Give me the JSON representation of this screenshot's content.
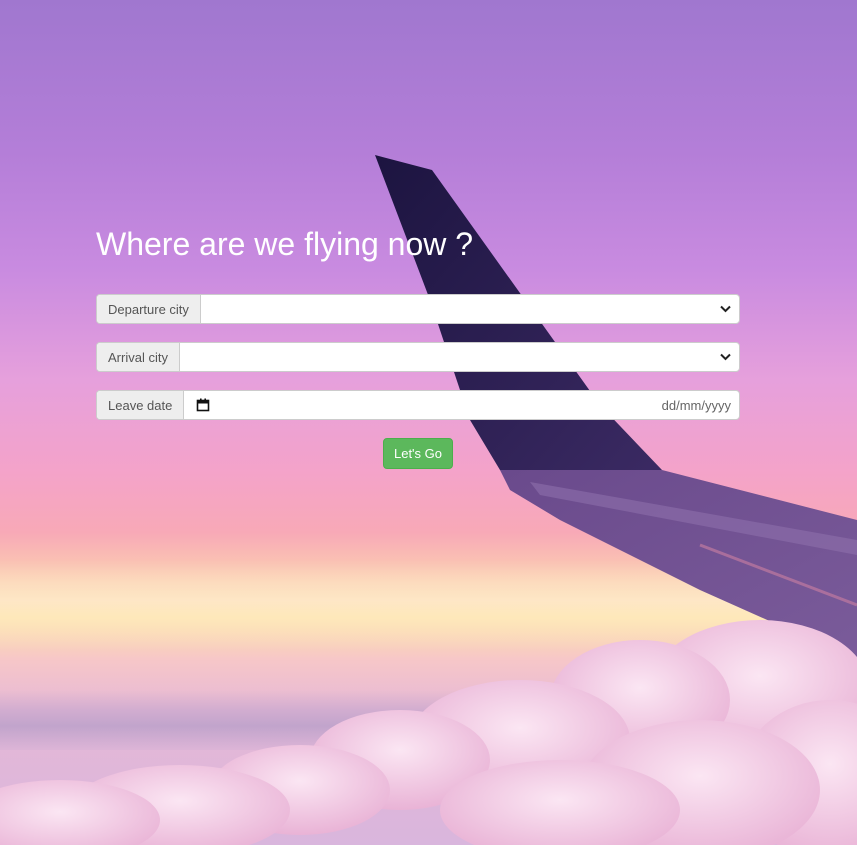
{
  "page": {
    "title": "Where are we flying now ?"
  },
  "form": {
    "departure": {
      "label": "Departure city",
      "value": ""
    },
    "arrival": {
      "label": "Arrival city",
      "value": ""
    },
    "leave_date": {
      "label": "Leave date",
      "placeholder": "dd/mm/yyyy",
      "icon": "calendar-icon"
    },
    "submit_label": "Let's Go"
  },
  "colors": {
    "button_bg": "#5cb85c",
    "title_text": "#ffffff",
    "addon_bg": "#eeeeee"
  },
  "background": {
    "subject": "airplane wing above pink sunset clouds"
  }
}
